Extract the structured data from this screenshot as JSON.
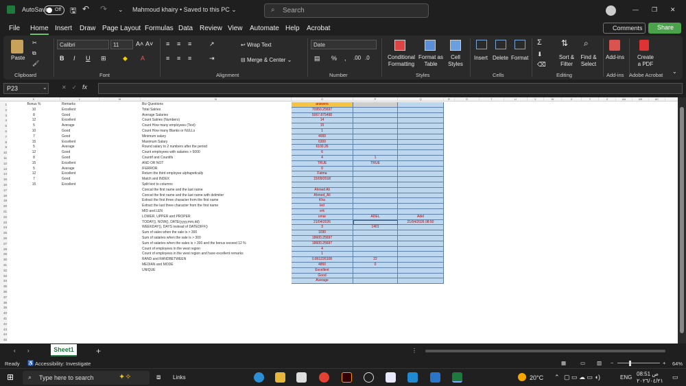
{
  "titlebar": {
    "autosave": "AutoSave",
    "toggle": "Off",
    "doc_title": "Mahmoud khairy  •  Saved to this PC ⌄",
    "search_placeholder": "Search"
  },
  "menu": [
    "File",
    "Home",
    "Insert",
    "Draw",
    "Page Layout",
    "Formulas",
    "Data",
    "Review",
    "View",
    "Automate",
    "Help",
    "Acrobat"
  ],
  "menu_right": {
    "comments": "Comments",
    "share": "Share"
  },
  "ribbon": {
    "paste": "Paste",
    "clipboard": "Clipboard",
    "font_name": "Calibri",
    "font_size": "11",
    "font": "Font",
    "wrap": "Wrap Text",
    "merge": "Merge & Center",
    "alignment": "Alignment",
    "number_format": "Date",
    "number": "Number",
    "cond": "Conditional Formatting",
    "format_table": "Format as Table",
    "cell_styles": "Cell Styles",
    "styles": "Styles",
    "insert": "Insert",
    "delete": "Delete",
    "format": "Format",
    "cells": "Cells",
    "sort": "Sort & Filter",
    "find": "Find & Select",
    "editing": "Editing",
    "addins": "Add-ins",
    "addins_group": "Add-ins",
    "create_pdf": "Create a PDF",
    "adobe": "Adobe Acrobat"
  },
  "formula": {
    "namebox": "P23",
    "fx": "fx"
  },
  "columns": [
    "K",
    "L",
    "M",
    "N",
    "O",
    "P",
    "Q",
    "R",
    "S",
    "T",
    "U",
    "V",
    "W",
    "X",
    "Y",
    "Z",
    "AA",
    "AB",
    "AC"
  ],
  "rows": [
    "1",
    "2",
    "3",
    "4",
    "5",
    "6",
    "7",
    "8",
    "9",
    "10",
    "11",
    "12",
    "13",
    "14",
    "15",
    "16",
    "17",
    "18",
    "19",
    "20",
    "21",
    "22",
    "23",
    "24",
    "25",
    "26",
    "27",
    "28",
    "29",
    "30",
    "31",
    "32",
    "33",
    "34",
    "35",
    "36",
    "37",
    "38",
    "39",
    "40",
    "41",
    "42",
    "43",
    "44",
    "45"
  ],
  "bonus": [
    "Bonus %",
    "10",
    "8",
    "12",
    "5",
    "10",
    "7",
    "15",
    "5",
    "12",
    "8",
    "15",
    "5",
    "12",
    "7",
    "15"
  ],
  "remarks": [
    "Remarks",
    "Excellent",
    "Good",
    "Excellent",
    "Average",
    "Good",
    "Good",
    "Excellent",
    "Average",
    "Good",
    "Good",
    "Excellent",
    "Average",
    "Excellent",
    "Good",
    "Excellent"
  ],
  "questions": [
    "Biz Questions",
    "Total Salries",
    "Average Salaries",
    "Count Salries (Numbers)",
    "Count How many employees (Text)",
    "Count How many Blanks or NULLs",
    "Minimum salary",
    "Maximum Salary",
    "Round salary to 2 numbers after the period",
    "Count employees with salaries > 5000",
    "Countif and Countifs",
    "AND OR NOT",
    "IFERROR",
    "Return the third employee alphapetically",
    "Match and INDEX",
    "Split text to columns",
    "Concat the first name and the last name",
    "Concat the first name and the last name with delimiter",
    "Extract the first three character from the first name",
    "Extract the last three character from the first name",
    "MID and LEN",
    "LOWER, UPPER and PROPER",
    "TODAY(), NOW(), DATE(yyyy,mm,dd)",
    "WEEKDAY(), DAYS instead of DATEDIFF()",
    "Sum of sales when the sale is > 300",
    "Sum of salaries when the sale is > 300",
    "Sum of salaries when the sales is > 300 and the bonus exceed 12 %",
    "Count of employees in the west region",
    "Count of employees in the west region and have excellent remarks",
    "RAND and RANDBETWEEN",
    "MEDIAN and MODE",
    "UNIQUE"
  ],
  "answers": [
    "answers",
    "70950.25697",
    "5067.875498",
    "14",
    "15",
    "1",
    "4000",
    "6300",
    "6100.26",
    "6",
    "4",
    "TRUE",
    "0",
    "Fatma",
    "15/09/2018",
    "",
    "Ahmed Ali",
    "Ahmed_Ali",
    "Kha",
    "led",
    "erk",
    "omar",
    "21/04/2026",
    "3",
    "1030",
    "18600.25697",
    "18600.25697",
    "4",
    "1",
    "0.861226108",
    "4850",
    "Excellent",
    "Good",
    "Average"
  ],
  "colP": {
    "r11": "1",
    "r12": "TRUE",
    "r22": "ADEL",
    "r24": "1401",
    "r30": "22",
    "r31": "0"
  },
  "colQ": {
    "r22": "Adel",
    "r23": "21/04/2026 08:50"
  },
  "tabs": {
    "sheet": "Sheet1"
  },
  "status": {
    "ready": "Ready",
    "access": "Accessibility: Investigate",
    "zoom": "64%"
  },
  "taskbar": {
    "search": "Type here to search",
    "links": "Links",
    "weather": "20°C",
    "lang": "ENG",
    "time": "08:51 ص",
    "date": "٢٠٢٦/٠٤/٢١"
  }
}
